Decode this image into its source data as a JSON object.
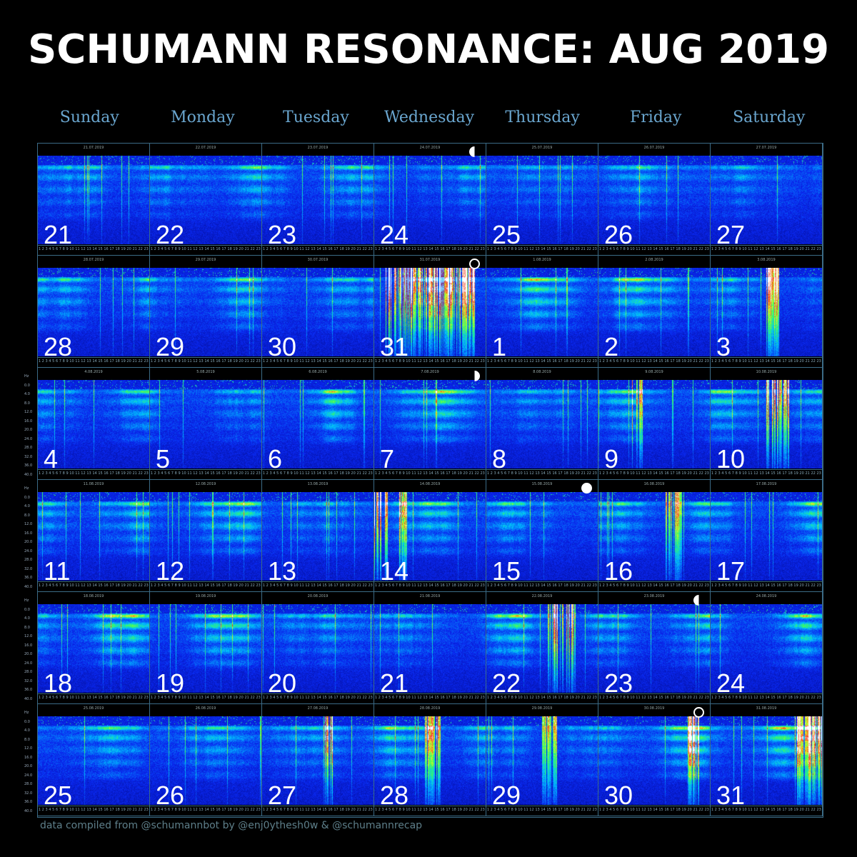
{
  "title": "SCHUMANN RESONANCE: AUG 2019",
  "weekdays": [
    "Sunday",
    "Monday",
    "Tuesday",
    "Wednesday",
    "Thursday",
    "Friday",
    "Saturday"
  ],
  "hours": [
    "1",
    "2",
    "3",
    "4",
    "5",
    "6",
    "7",
    "8",
    "9",
    "10",
    "11",
    "12",
    "13",
    "14",
    "15",
    "16",
    "17",
    "18",
    "19",
    "20",
    "21",
    "22",
    "23"
  ],
  "frequency_axis": [
    "Hz",
    "0.0",
    "4.0",
    "8.0",
    "12.0",
    "16.0",
    "20.0",
    "24.0",
    "28.0",
    "32.0",
    "36.0",
    "40.0"
  ],
  "weeks": [
    [
      {
        "day": "21",
        "date": "21.07.2019"
      },
      {
        "day": "22",
        "date": "22.07.2019"
      },
      {
        "day": "23",
        "date": "23.07.2019"
      },
      {
        "day": "24",
        "date": "24.07.2019",
        "moon": "last-quarter"
      },
      {
        "day": "25",
        "date": "25.07.2019"
      },
      {
        "day": "26",
        "date": "26.07.2019"
      },
      {
        "day": "27",
        "date": "27.07.2019"
      }
    ],
    [
      {
        "day": "28",
        "date": "28.07.2019"
      },
      {
        "day": "29",
        "date": "29.07.2019"
      },
      {
        "day": "30",
        "date": "30.07.2019"
      },
      {
        "day": "31",
        "date": "31.07.2019",
        "moon": "new"
      },
      {
        "day": "1",
        "date": "1.08.2019"
      },
      {
        "day": "2",
        "date": "2.08.2019"
      },
      {
        "day": "3",
        "date": "3.08.2019"
      }
    ],
    [
      {
        "day": "4",
        "date": "4.08.2019"
      },
      {
        "day": "5",
        "date": "5.08.2019"
      },
      {
        "day": "6",
        "date": "6.08.2019"
      },
      {
        "day": "7",
        "date": "7.08.2019",
        "moon": "first-quarter"
      },
      {
        "day": "8",
        "date": "8.08.2019"
      },
      {
        "day": "9",
        "date": "9.08.2019"
      },
      {
        "day": "10",
        "date": "10.08.2019"
      }
    ],
    [
      {
        "day": "11",
        "date": "11.08.2019"
      },
      {
        "day": "12",
        "date": "12.08.2019"
      },
      {
        "day": "13",
        "date": "13.08.2019"
      },
      {
        "day": "14",
        "date": "14.08.2019"
      },
      {
        "day": "15",
        "date": "15.08.2019",
        "moon": "full"
      },
      {
        "day": "16",
        "date": "16.08.2019"
      },
      {
        "day": "17",
        "date": "17.08.2019"
      }
    ],
    [
      {
        "day": "18",
        "date": "18.08.2019"
      },
      {
        "day": "19",
        "date": "19.08.2019"
      },
      {
        "day": "20",
        "date": "20.08.2019"
      },
      {
        "day": "21",
        "date": "21.08.2019"
      },
      {
        "day": "22",
        "date": "22.08.2019"
      },
      {
        "day": "23",
        "date": "23.08.2019",
        "moon": "last-quarter"
      },
      {
        "day": "24",
        "date": "24.08.2019"
      }
    ],
    [
      {
        "day": "25",
        "date": "25.08.2019"
      },
      {
        "day": "26",
        "date": "26.08.2019"
      },
      {
        "day": "27",
        "date": "27.08.2019"
      },
      {
        "day": "28",
        "date": "28.08.2019"
      },
      {
        "day": "29",
        "date": "29.08.2019"
      },
      {
        "day": "30",
        "date": "30.08.2019",
        "moon": "new"
      },
      {
        "day": "31",
        "date": "31.08.2019"
      }
    ]
  ],
  "footer": "data compiled from @schumannbot by @enj0ythesh0w & @schumannrecap"
}
